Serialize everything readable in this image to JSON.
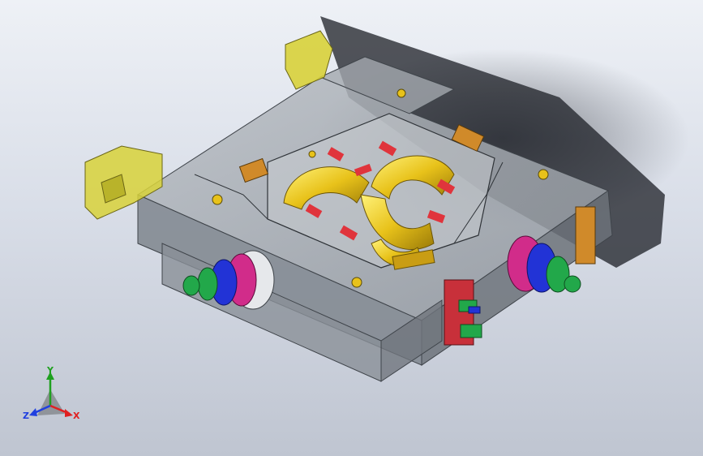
{
  "viewport": {
    "background_top": "#eef1f6",
    "background_bottom": "#bfc5d1"
  },
  "model": {
    "icon": "mold-assembly-3d-model",
    "colors": {
      "mold_body": "#9ca3ab",
      "mold_edge": "#3f444a",
      "runner_gold": "#e8c21a",
      "clamp_yellow": "#d8d23a",
      "insert_red": "#e0343c",
      "cylinder_green": "#22a84a",
      "cylinder_blue": "#2233d6",
      "cylinder_magenta": "#d12c8a",
      "connector_orange": "#d08a2a"
    }
  },
  "triad": {
    "y_label": "Y",
    "z_label": "Z",
    "x_label": "X",
    "colors": {
      "x": "#e02020",
      "y": "#1fa01f",
      "z": "#2040e0"
    }
  }
}
